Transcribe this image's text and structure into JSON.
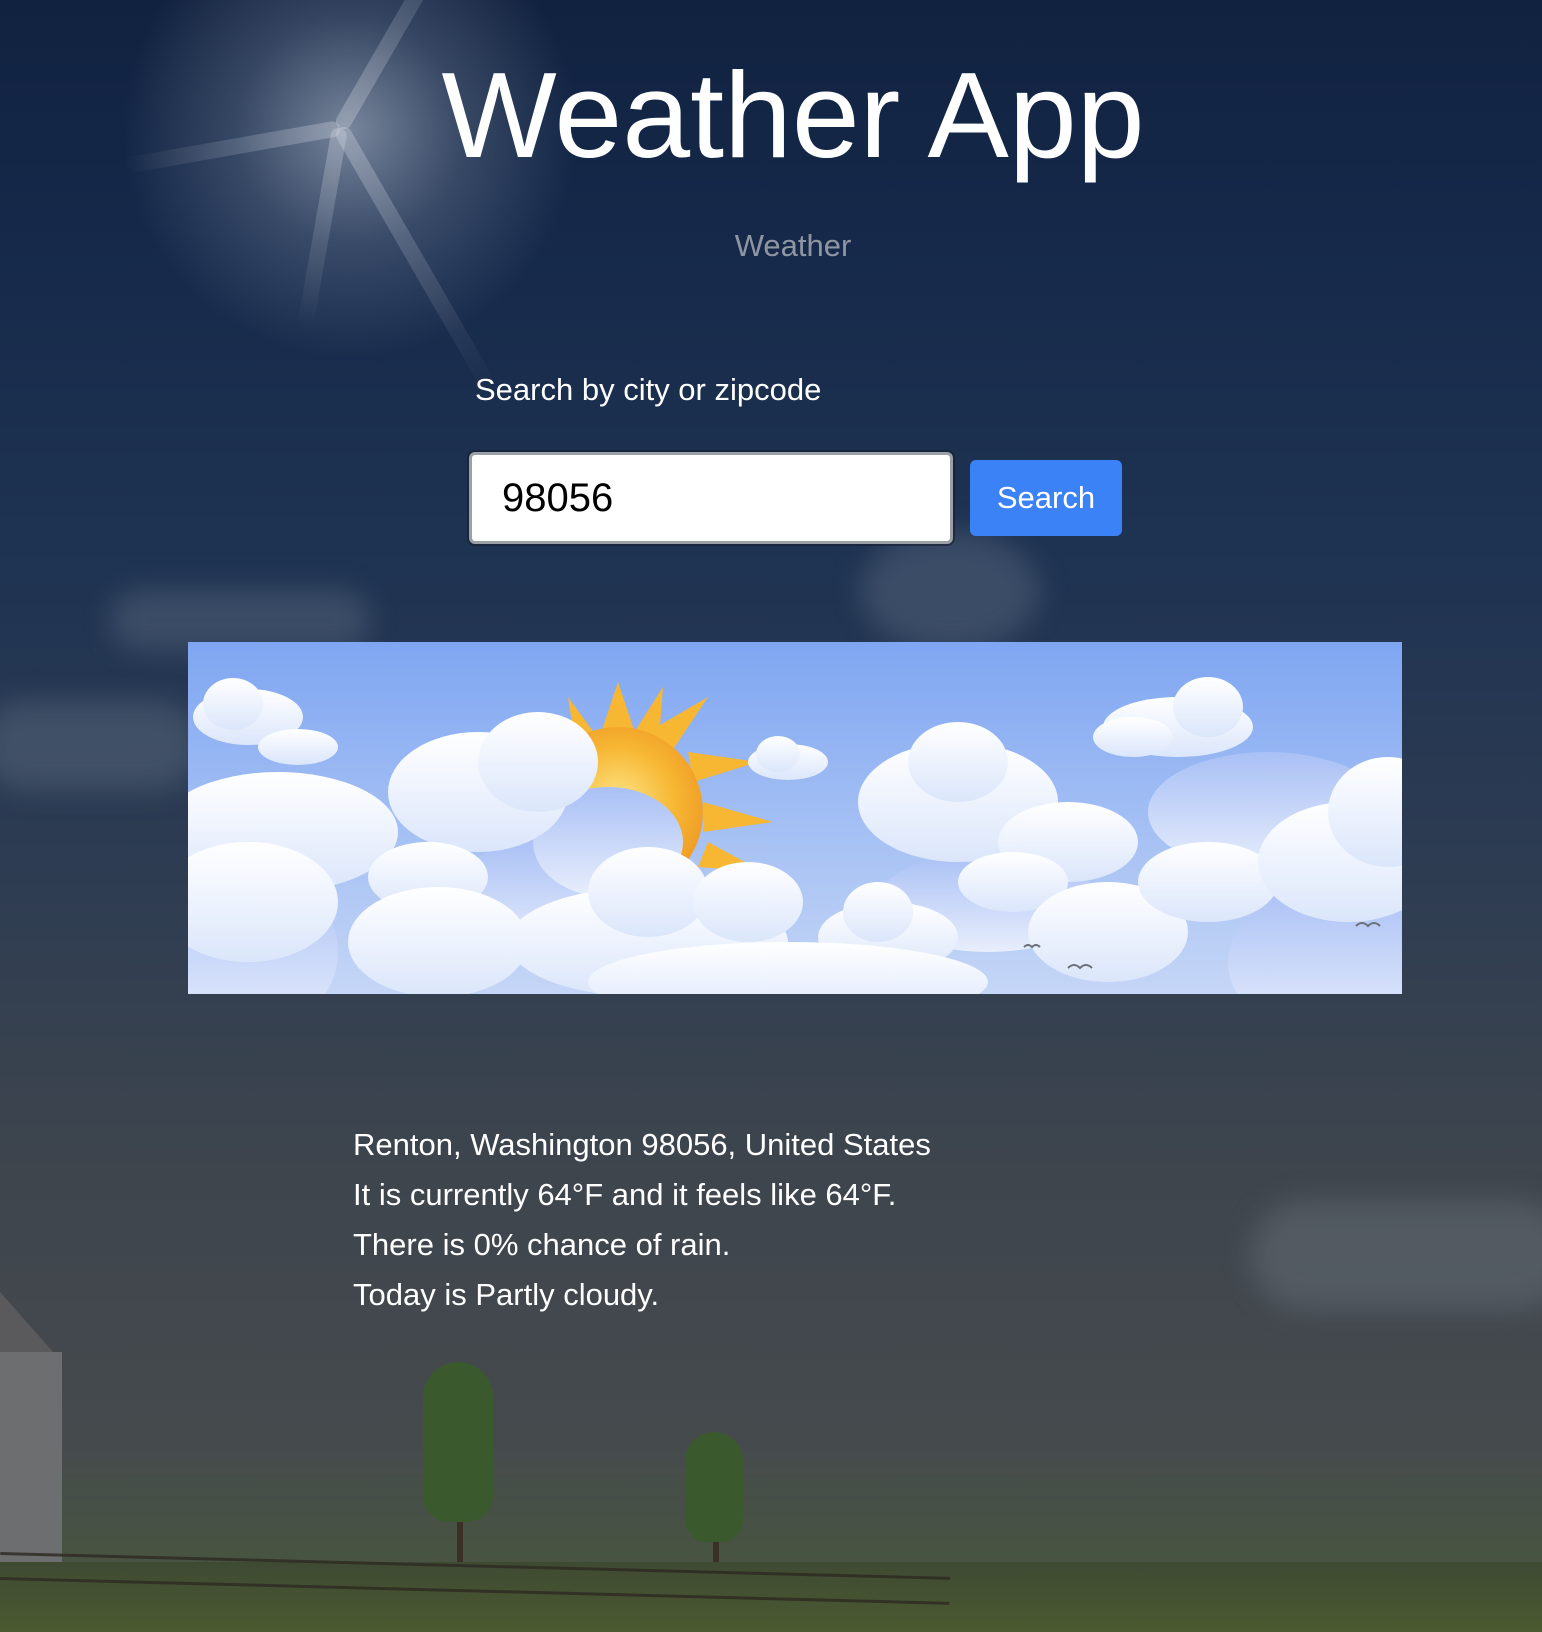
{
  "header": {
    "title": "Weather App",
    "subtitle": "Weather"
  },
  "search": {
    "label": "Search by city or zipcode",
    "value": "98056",
    "button_label": "Search"
  },
  "weather_image": {
    "icon": "partly-cloudy-illustration"
  },
  "result": {
    "location": "Renton, Washington 98056, United States",
    "temperature": "It is currently 64°F and it feels like 64°F.",
    "rain": "There is 0% chance of rain.",
    "condition": "Today is Partly cloudy."
  },
  "colors": {
    "button": "#3b82f6",
    "subtitle": "#8e96a2"
  }
}
